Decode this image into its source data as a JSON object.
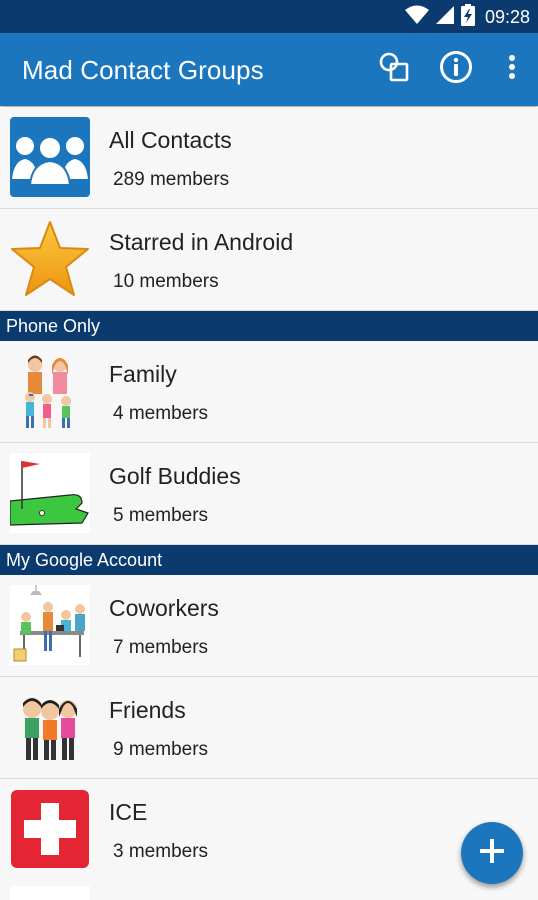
{
  "status_bar": {
    "time": "09:28",
    "icons": [
      "wifi-icon",
      "signal-icon",
      "battery-charging-icon"
    ]
  },
  "app_bar": {
    "title": "Mad Contact Groups",
    "actions": [
      "groups-shapes-icon",
      "info-icon",
      "overflow-menu-icon"
    ]
  },
  "groups": [
    {
      "name": "All Contacts",
      "members": "289 members",
      "icon": "contacts-group-icon"
    },
    {
      "name": "Starred in Android",
      "members": "10 members",
      "icon": "star-icon"
    }
  ],
  "sections": [
    {
      "title": "Phone Only",
      "groups": [
        {
          "name": "Family",
          "members": "4 members",
          "icon": "family-icon"
        },
        {
          "name": "Golf Buddies",
          "members": "5 members",
          "icon": "golf-icon"
        }
      ]
    },
    {
      "title": "My Google Account",
      "groups": [
        {
          "name": "Coworkers",
          "members": "7 members",
          "icon": "coworkers-icon"
        },
        {
          "name": "Friends",
          "members": "9 members",
          "icon": "friends-icon"
        },
        {
          "name": "ICE",
          "members": "3 members",
          "icon": "medical-cross-icon"
        }
      ]
    }
  ],
  "fab": {
    "icon": "plus-icon"
  },
  "colors": {
    "app_bar": "#1c76bd",
    "status_bar": "#0a3a6e",
    "section_header": "#0a3a6e",
    "star": "#f4a81c",
    "ice": "#e32534",
    "golf_green": "#3dc640"
  }
}
